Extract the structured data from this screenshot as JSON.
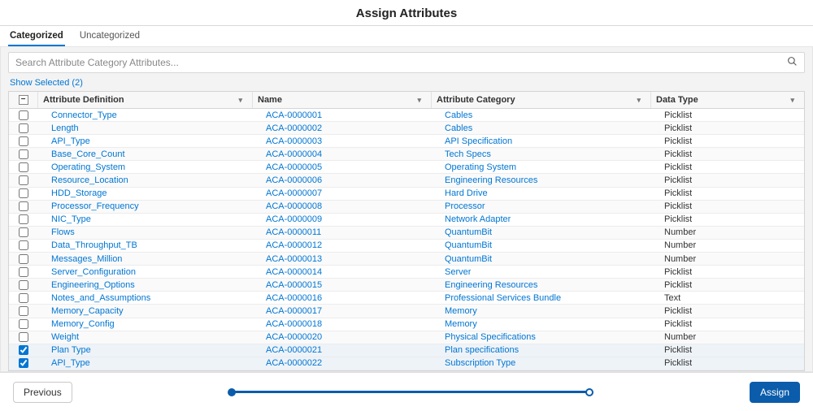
{
  "title": "Assign Attributes",
  "tabs": {
    "categorized": "Categorized",
    "uncategorized": "Uncategorized"
  },
  "search": {
    "placeholder": "Search Attribute Category Attributes..."
  },
  "show_selected": "Show Selected (2)",
  "columns": {
    "definition": "Attribute Definition",
    "name": "Name",
    "category": "Attribute Category",
    "data_type": "Data Type"
  },
  "rows": [
    {
      "def": "Connector_Type",
      "name": "ACA-0000001",
      "cat": "Cables",
      "type": "Picklist",
      "checked": false
    },
    {
      "def": "Length",
      "name": "ACA-0000002",
      "cat": "Cables",
      "type": "Picklist",
      "checked": false
    },
    {
      "def": "API_Type",
      "name": "ACA-0000003",
      "cat": "API Specification",
      "type": "Picklist",
      "checked": false
    },
    {
      "def": "Base_Core_Count",
      "name": "ACA-0000004",
      "cat": "Tech Specs",
      "type": "Picklist",
      "checked": false
    },
    {
      "def": "Operating_System",
      "name": "ACA-0000005",
      "cat": "Operating System",
      "type": "Picklist",
      "checked": false
    },
    {
      "def": "Resource_Location",
      "name": "ACA-0000006",
      "cat": "Engineering Resources",
      "type": "Picklist",
      "checked": false
    },
    {
      "def": "HDD_Storage",
      "name": "ACA-0000007",
      "cat": "Hard Drive",
      "type": "Picklist",
      "checked": false
    },
    {
      "def": "Processor_Frequency",
      "name": "ACA-0000008",
      "cat": "Processor",
      "type": "Picklist",
      "checked": false
    },
    {
      "def": "NIC_Type",
      "name": "ACA-0000009",
      "cat": "Network Adapter",
      "type": "Picklist",
      "checked": false
    },
    {
      "def": "Flows",
      "name": "ACA-0000011",
      "cat": "QuantumBit",
      "type": "Number",
      "checked": false
    },
    {
      "def": "Data_Throughput_TB",
      "name": "ACA-0000012",
      "cat": "QuantumBit",
      "type": "Number",
      "checked": false
    },
    {
      "def": "Messages_Million",
      "name": "ACA-0000013",
      "cat": "QuantumBit",
      "type": "Number",
      "checked": false
    },
    {
      "def": "Server_Configuration",
      "name": "ACA-0000014",
      "cat": "Server",
      "type": "Picklist",
      "checked": false
    },
    {
      "def": "Engineering_Options",
      "name": "ACA-0000015",
      "cat": "Engineering Resources",
      "type": "Picklist",
      "checked": false
    },
    {
      "def": "Notes_and_Assumptions",
      "name": "ACA-0000016",
      "cat": "Professional Services Bundle",
      "type": "Text",
      "checked": false
    },
    {
      "def": "Memory_Capacity",
      "name": "ACA-0000017",
      "cat": "Memory",
      "type": "Picklist",
      "checked": false
    },
    {
      "def": "Memory_Config",
      "name": "ACA-0000018",
      "cat": "Memory",
      "type": "Picklist",
      "checked": false
    },
    {
      "def": "Weight",
      "name": "ACA-0000020",
      "cat": "Physical Specifications",
      "type": "Number",
      "checked": false
    },
    {
      "def": "Plan Type",
      "name": "ACA-0000021",
      "cat": "Plan specifications",
      "type": "Picklist",
      "checked": true
    },
    {
      "def": "API_Type",
      "name": "ACA-0000022",
      "cat": "Subscription Type",
      "type": "Picklist",
      "checked": true
    }
  ],
  "footer": {
    "previous": "Previous",
    "assign": "Assign"
  }
}
